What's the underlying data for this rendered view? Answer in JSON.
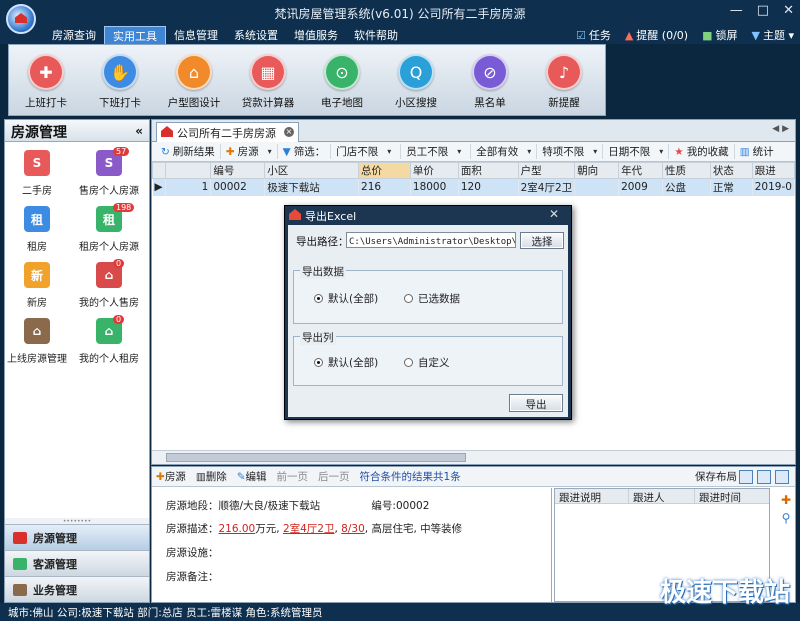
{
  "app": {
    "title": "梵讯房屋管理系统(v6.01) 公司所有二手房房源",
    "window_buttons": [
      "—",
      "□",
      "✕"
    ]
  },
  "menu": [
    "房源查询",
    "实用工具",
    "信息管理",
    "系统设置",
    "增值服务",
    "软件帮助"
  ],
  "menu_active": "实用工具",
  "right_menu": {
    "task": "任务",
    "remind": "提醒 (0/0)",
    "lock": "锁屏",
    "theme": "主题"
  },
  "tools": [
    {
      "label": "上班打卡",
      "color": "#e85a5a",
      "icon": "clock-in-icon",
      "glyph": "✚"
    },
    {
      "label": "下班打卡",
      "color": "#3d8be3",
      "icon": "clock-out-icon",
      "glyph": "✋"
    },
    {
      "label": "户型图设计",
      "color": "#f08a2a",
      "icon": "floorplan-icon",
      "glyph": "⌂"
    },
    {
      "label": "贷款计算器",
      "color": "#e95a5a",
      "icon": "calculator-icon",
      "glyph": "▦"
    },
    {
      "label": "电子地图",
      "color": "#3ab36a",
      "icon": "map-pin-icon",
      "glyph": "⊙"
    },
    {
      "label": "小区搜搜",
      "color": "#2a9fd8",
      "icon": "search-icon",
      "glyph": "Q"
    },
    {
      "label": "黑名单",
      "color": "#7a5bd6",
      "icon": "blacklist-icon",
      "glyph": "⊘"
    },
    {
      "label": "新提醒",
      "color": "#e85a5a",
      "icon": "bell-icon",
      "glyph": "♪"
    }
  ],
  "left_panel": {
    "title": "房源管理",
    "collapse": "«",
    "items": [
      {
        "label": "二手房",
        "color": "#e85a5a",
        "glyph": "S",
        "count": ""
      },
      {
        "label": "售房个人房源",
        "color": "#8a5bc8",
        "glyph": "S",
        "count": "57"
      },
      {
        "label": "租房",
        "color": "#3d8be3",
        "glyph": "租",
        "count": ""
      },
      {
        "label": "租房个人房源",
        "color": "#3ab36a",
        "glyph": "租",
        "count": "198"
      },
      {
        "label": "新房",
        "color": "#f0a22a",
        "glyph": "新",
        "count": ""
      },
      {
        "label": "我的个人售房",
        "color": "#d94a4a",
        "glyph": "⌂",
        "count": "0"
      },
      {
        "label": "上线房源管理",
        "color": "#8a6a4a",
        "glyph": "⌂",
        "count": ""
      },
      {
        "label": "我的个人租房",
        "color": "#3ab36a",
        "glyph": "⌂",
        "count": "0"
      }
    ],
    "nav": [
      {
        "label": "房源管理",
        "color": "#d9302c"
      },
      {
        "label": "客源管理",
        "color": "#3ab36a"
      },
      {
        "label": "业务管理",
        "color": "#8a6a4a"
      }
    ]
  },
  "tab": {
    "label": "公司所有二手房房源",
    "nav": "◀ ▶"
  },
  "filterbar": {
    "refresh": "刷新结果",
    "house": "房源",
    "filter": "筛选：",
    "store": "门店不限",
    "staff": "员工不限",
    "validity": "全部有效",
    "special": "特项不限",
    "date": "日期不限",
    "favorite": "我的收藏",
    "stats": "统计"
  },
  "grid": {
    "columns": [
      "",
      "",
      "编号",
      "小区",
      "总价",
      "单价",
      "面积",
      "户型",
      "朝向",
      "年代",
      "性质",
      "状态",
      "跟进"
    ],
    "row": [
      "▶",
      "1",
      "00002",
      "极速下载站",
      "216",
      "18000",
      "120",
      "2室4厅2卫",
      "",
      "2009",
      "公盘",
      "正常",
      "2019-0"
    ]
  },
  "dialog": {
    "title": "导出Excel",
    "close": "✕",
    "path_label": "导出路径：",
    "path_value": "C:\\Users\\Administrator\\Desktop\\导出",
    "choose": "选择",
    "group1": "导出数据",
    "g1_opt1": "默认(全部)",
    "g1_opt2": "已选数据",
    "group2": "导出列",
    "g2_opt1": "默认(全部)",
    "g2_opt2": "自定义",
    "export": "导出"
  },
  "bottom_toolbar": {
    "house": "房源",
    "delete": "删除",
    "edit": "编辑",
    "prev": "前一页",
    "next": "后一页",
    "result": "符合条件的结果共1条",
    "save_layout": "保存布局"
  },
  "detail": {
    "location_label": "房源地段：",
    "location": "顺德/大良/极速下载站",
    "id_label": "编号:",
    "id": "00002",
    "desc_label": "房源描述：",
    "price": "216.00",
    "price_unit": "万元,",
    "layout": "2室4厅2卫",
    "floor": "8/30",
    "desc_rest": "高层住宅, 中等装修",
    "facility_label": "房源设施：",
    "note_label": "房源备注："
  },
  "follow": {
    "columns": [
      "跟进说明",
      "跟进人",
      "跟进时间"
    ]
  },
  "statusbar": "城市:佛山  公司:极速下载站  部门:总店  员工:雷楼谋  角色:系统管理员",
  "watermark": "极速下载站"
}
